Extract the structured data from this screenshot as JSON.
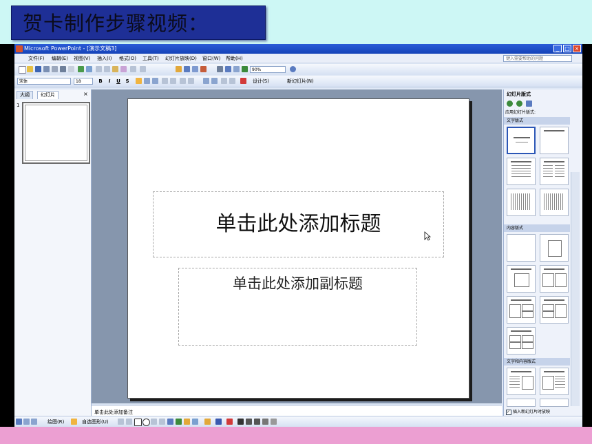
{
  "lesson_title": "贺卡制作步骤视频：",
  "window": {
    "title": "Microsoft PowerPoint - [演示文稿3]",
    "buttons": [
      "_",
      "□",
      "×"
    ]
  },
  "menu": {
    "items": [
      "文件(F)",
      "编辑(E)",
      "视图(V)",
      "插入(I)",
      "格式(O)",
      "工具(T)",
      "幻灯片放映(D)",
      "窗口(W)",
      "帮助(H)"
    ],
    "help_placeholder": "键入需要帮助的问题"
  },
  "toolbar": {
    "zoom": "90%"
  },
  "format_bar": {
    "font": "宋体",
    "size": "18",
    "bold": "B",
    "italic": "I",
    "underline": "U",
    "shadow": "S",
    "design_label": "设计(S)",
    "new_slide_label": "新幻灯片(N)"
  },
  "left_pane": {
    "tabs": [
      "大纲",
      "幻灯片"
    ],
    "slide_number": "1",
    "close": "×"
  },
  "slide": {
    "title_placeholder": "单击此处添加标题",
    "subtitle_placeholder": "单击此处添加副标题"
  },
  "notes_placeholder": "单击此处添加备注",
  "task_pane": {
    "title": "幻灯片版式",
    "apply_label": "应用幻灯片版式:",
    "section_text_layouts": "文字版式",
    "section_content_layouts": "内容版式",
    "section_text_content_layouts": "文字和内容版式",
    "show_when_inserting": "插入新幻灯片时放映"
  },
  "draw_bar": {
    "draw_label": "绘图(R)",
    "autoshapes_label": "自选图形(U)"
  }
}
